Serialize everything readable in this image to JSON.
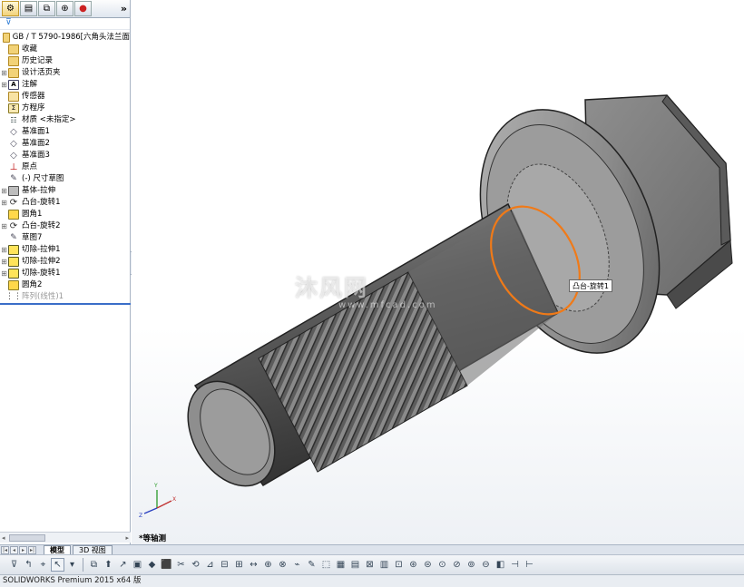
{
  "feature_manager": {
    "tabs": [
      {
        "icon": "feature-manager-icon",
        "glyph": "⚙"
      },
      {
        "icon": "property-manager-icon",
        "glyph": "▤"
      },
      {
        "icon": "configuration-manager-icon",
        "glyph": "⧉"
      },
      {
        "icon": "dimxpert-icon",
        "glyph": "⊕"
      },
      {
        "icon": "display-manager-icon",
        "glyph": "●"
      }
    ],
    "expand_glyph": "»",
    "filter_glyph": "⊽",
    "root": "GB / T 5790-1986[六角头法兰面",
    "items": [
      {
        "label": "收藏",
        "icon": "folder-icon",
        "expandable": false
      },
      {
        "label": "历史记录",
        "icon": "history-icon",
        "expandable": false
      },
      {
        "label": "设计活页夹",
        "icon": "binder-icon",
        "expandable": true
      },
      {
        "label": "注解",
        "icon": "annotation-icon",
        "expandable": true
      },
      {
        "label": "传感器",
        "icon": "sensor-icon",
        "expandable": false
      },
      {
        "label": "方程序",
        "icon": "equation-icon",
        "expandable": false
      },
      {
        "label": "材质 <未指定>",
        "icon": "material-icon",
        "expandable": false
      },
      {
        "label": "基准面1",
        "icon": "plane-icon",
        "expandable": false
      },
      {
        "label": "基准面2",
        "icon": "plane-icon",
        "expandable": false
      },
      {
        "label": "基准面3",
        "icon": "plane-icon",
        "expandable": false
      },
      {
        "label": "原点",
        "icon": "origin-icon",
        "expandable": false
      },
      {
        "label": "(-) 尺寸草图",
        "icon": "sketch-icon",
        "expandable": false
      },
      {
        "label": "基体-拉伸",
        "icon": "extrude-icon",
        "expandable": true
      },
      {
        "label": "凸台-旋转1",
        "icon": "revolve-icon",
        "expandable": true
      },
      {
        "label": "圆角1",
        "icon": "fillet-icon",
        "expandable": false
      },
      {
        "label": "凸台-旋转2",
        "icon": "revolve-icon",
        "expandable": true
      },
      {
        "label": "草图7",
        "icon": "sketch-icon",
        "expandable": false
      },
      {
        "label": "切除-拉伸1",
        "icon": "cut-extrude-icon",
        "expandable": true
      },
      {
        "label": "切除-拉伸2",
        "icon": "cut-extrude-icon",
        "expandable": true
      },
      {
        "label": "切除-旋转1",
        "icon": "cut-revolve-icon",
        "expandable": true
      },
      {
        "label": "圆角2",
        "icon": "fillet-icon",
        "expandable": false
      },
      {
        "label": "阵列(线性)1",
        "icon": "pattern-icon",
        "expandable": false,
        "dim": true
      }
    ],
    "scroll_left": "◂",
    "scroll_right": "▸",
    "scroll_grip": "|||"
  },
  "bottom_tabs": {
    "arrows": [
      "|◂",
      "◂",
      "▸",
      "▸|"
    ],
    "model": "模型",
    "view3d": "3D 视图"
  },
  "viewport": {
    "tooltip": "凸台-旋转1",
    "view_orientation": "*等轴测",
    "watermark_brand": "沐风网",
    "watermark_url": "www.mfcad.com",
    "triad": {
      "x": "X",
      "y": "Y",
      "z": "Z"
    }
  },
  "toolbar": {
    "buttons": [
      "⊽",
      "↰",
      "⌖",
      "↖",
      "▾",
      "⧉",
      "⬆",
      "↗",
      "▣",
      "◆",
      "⬛",
      "✂",
      "⟲",
      "⊿",
      "⊟",
      "⊞",
      "↔",
      "⊕",
      "⊗",
      "⌁",
      "✎",
      "⬚",
      "▦",
      "▤",
      "⊠",
      "▥",
      "⊡",
      "⊛",
      "⊜",
      "⊙",
      "⊘",
      "⊚",
      "⊖",
      "◧",
      "⊣",
      "⊢"
    ]
  },
  "status_bar": {
    "text": "SOLIDWORKS Premium 2015 x64 版"
  },
  "colors": {
    "highlight_orange": "#f07a18",
    "rollback_blue": "#3a6ec8"
  }
}
